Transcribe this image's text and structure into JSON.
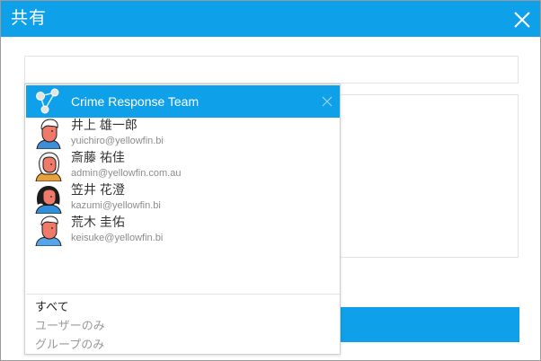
{
  "dialog": {
    "title": "共有",
    "close_icon": "close-icon"
  },
  "colors": {
    "accent": "#0fa0ea",
    "text_primary": "#333333",
    "text_secondary": "#8c8c8c"
  },
  "dropdown": {
    "team": {
      "label": "Crime Response Team",
      "icon": "group-icon",
      "remove_icon": "remove-icon"
    },
    "users": [
      {
        "name": "井上 雄一郎",
        "email": "yuichiro@yellowfin.bi",
        "icon": "avatar-male-icon"
      },
      {
        "name": "斎藤 祐佳",
        "email": "admin@yellowfin.com.au",
        "icon": "avatar-female-icon"
      },
      {
        "name": "笠井 花澄",
        "email": "kazumi@yellowfin.bi",
        "icon": "avatar-female-icon"
      },
      {
        "name": "荒木 圭佑",
        "email": "keisuke@yellowfin.bi",
        "icon": "avatar-male-icon"
      }
    ],
    "filters": [
      {
        "label": "すべて",
        "selected": true
      },
      {
        "label": "ユーザーのみ",
        "selected": false
      },
      {
        "label": "グループのみ",
        "selected": false
      }
    ]
  }
}
